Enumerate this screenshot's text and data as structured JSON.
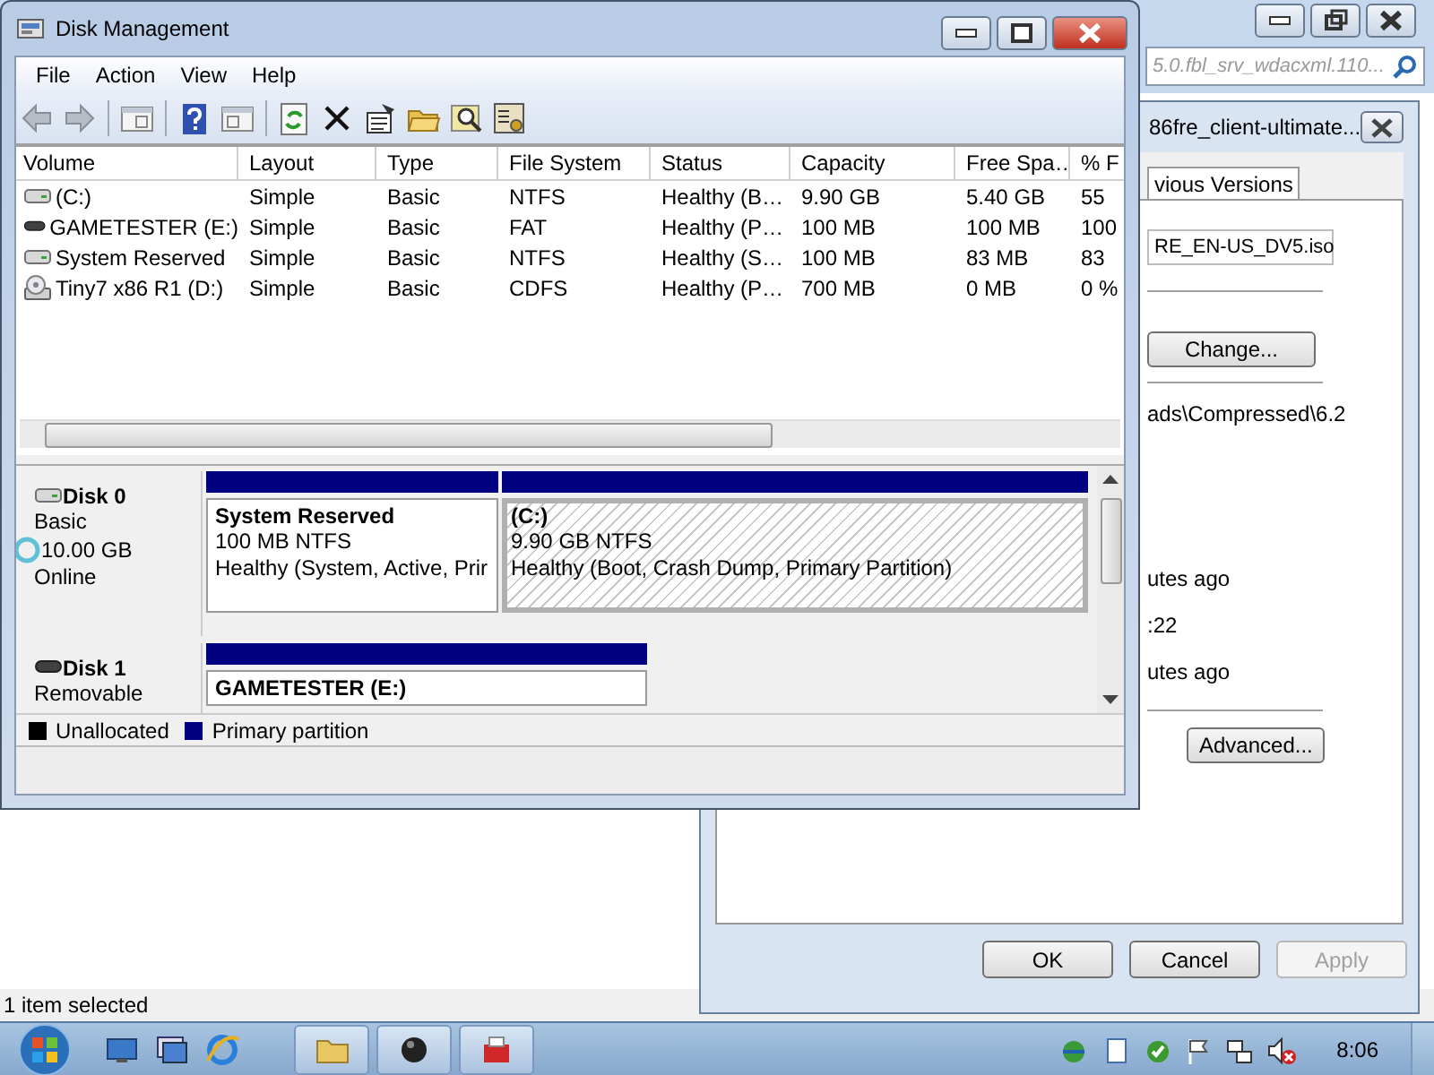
{
  "background_window": {
    "search_field": {
      "value": "5.0.fbl_srv_wdacxml.110..."
    },
    "status_bar": "1 item selected"
  },
  "properties_dialog": {
    "title": "86fre_client-ultimate...",
    "tabs": [
      {
        "label": "vious Versions",
        "selected": true
      }
    ],
    "file_name": "RE_EN-US_DV5.iso",
    "change_button": "Change...",
    "location": "ads\\Compressed\\6.2",
    "times": [
      "utes ago",
      ":22",
      "utes ago"
    ],
    "advanced_button": "Advanced...",
    "buttons": [
      {
        "label": "OK",
        "disabled": false
      },
      {
        "label": "Cancel",
        "disabled": false
      },
      {
        "label": "Apply",
        "disabled": true
      }
    ]
  },
  "window": {
    "title": "Disk Management",
    "menu": [
      "File",
      "Action",
      "View",
      "Help"
    ],
    "table": {
      "columns": [
        "Volume",
        "Layout",
        "Type",
        "File System",
        "Status",
        "Capacity",
        "Free Spa…",
        "% F"
      ],
      "rows": [
        {
          "kind": "hdd",
          "cells": [
            "(C:)",
            "Simple",
            "Basic",
            "NTFS",
            "Healthy (B…",
            "9.90 GB",
            "5.40 GB",
            "55"
          ]
        },
        {
          "kind": "removable",
          "cells": [
            "GAMETESTER (E:)",
            "Simple",
            "Basic",
            "FAT",
            "Healthy (P…",
            "100 MB",
            "100 MB",
            "100"
          ]
        },
        {
          "kind": "hdd",
          "cells": [
            "System Reserved",
            "Simple",
            "Basic",
            "NTFS",
            "Healthy (S…",
            "100 MB",
            "83 MB",
            "83"
          ]
        },
        {
          "kind": "cdrom",
          "cells": [
            "Tiny7 x86 R1 (D:)",
            "Simple",
            "Basic",
            "CDFS",
            "Healthy (P…",
            "700 MB",
            "0 MB",
            "0 %"
          ]
        }
      ]
    },
    "disks": [
      {
        "kind": "hdd",
        "name": "Disk 0",
        "type": "Basic",
        "size": "10.00 GB",
        "status": "Online",
        "partitions": [
          {
            "name": "System Reserved",
            "size": "100 MB NTFS",
            "health": "Healthy (System, Active, Prir",
            "selected": false
          },
          {
            "name": "(C:)",
            "size": "9.90 GB NTFS",
            "health": "Healthy (Boot, Crash Dump, Primary Partition)",
            "selected": true
          }
        ]
      },
      {
        "kind": "removable",
        "name": "Disk 1",
        "type": "Removable",
        "partitions": [
          {
            "name": "GAMETESTER  (E:)",
            "selected": false
          }
        ]
      }
    ],
    "legend": [
      {
        "label": "Unallocated",
        "color": "#000000"
      },
      {
        "label": "Primary partition",
        "color": "#000080"
      }
    ]
  },
  "taskbar": {
    "clock": "8:06"
  }
}
